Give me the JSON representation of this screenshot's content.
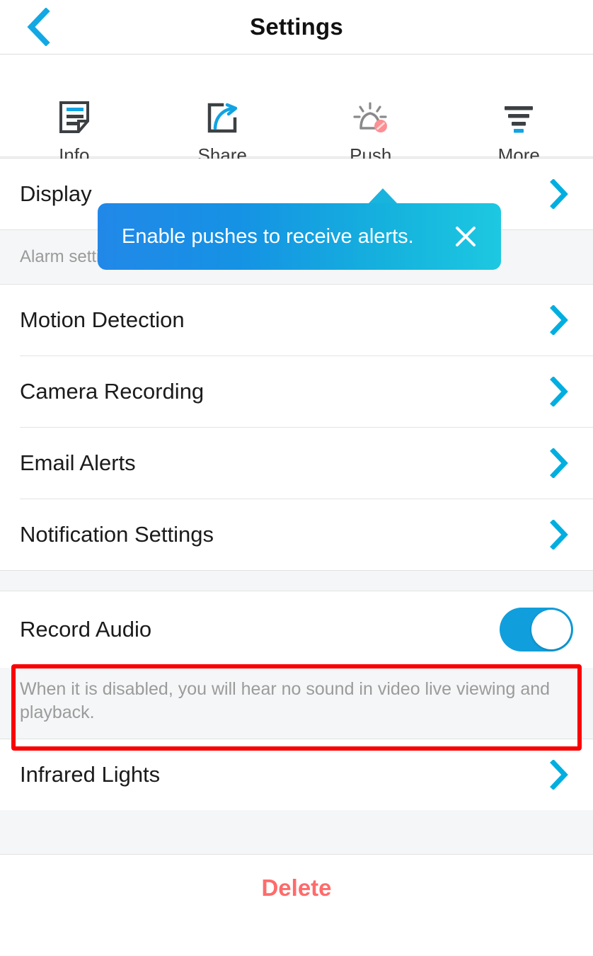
{
  "header": {
    "title": "Settings",
    "back_icon": "chevron-left-icon"
  },
  "quick_actions": [
    {
      "label": "Info",
      "icon": "document-info-icon"
    },
    {
      "label": "Share",
      "icon": "share-arrow-icon"
    },
    {
      "label": "Push",
      "icon": "bell-disabled-icon"
    },
    {
      "label": "More",
      "icon": "filter-more-icon"
    }
  ],
  "tooltip": {
    "message": "Enable pushes to receive alerts.",
    "close_icon": "close-icon",
    "gradient_start": "#2288e8",
    "gradient_end": "#1dc8e1",
    "points_to": "Push"
  },
  "display_section": {
    "rows": [
      {
        "label": "Display",
        "accessory": "chevron-right-icon"
      }
    ]
  },
  "alarm_section": {
    "title": "Alarm settings",
    "rows": [
      {
        "label": "Motion Detection",
        "accessory": "chevron-right-icon"
      },
      {
        "label": "Camera Recording",
        "accessory": "chevron-right-icon"
      },
      {
        "label": "Email Alerts",
        "accessory": "chevron-right-icon"
      },
      {
        "label": "Notification Settings",
        "accessory": "chevron-right-icon"
      }
    ]
  },
  "audio_section": {
    "row_label": "Record Audio",
    "toggle_state": "on",
    "toggle_color": "#109fdc",
    "helper_text": "When it is disabled, you will hear no sound in video live viewing and playback."
  },
  "infrared_section": {
    "rows": [
      {
        "label": "Infrared Lights",
        "accessory": "chevron-right-icon"
      }
    ]
  },
  "footer": {
    "delete_label": "Delete",
    "delete_color": "#ff6b6b"
  },
  "annotation": {
    "target": "Record Audio",
    "border_color": "#fb0000"
  },
  "theme": {
    "accent": "#00aee0",
    "page_bg": "#ffffff",
    "group_bg": "#f5f6f7"
  }
}
